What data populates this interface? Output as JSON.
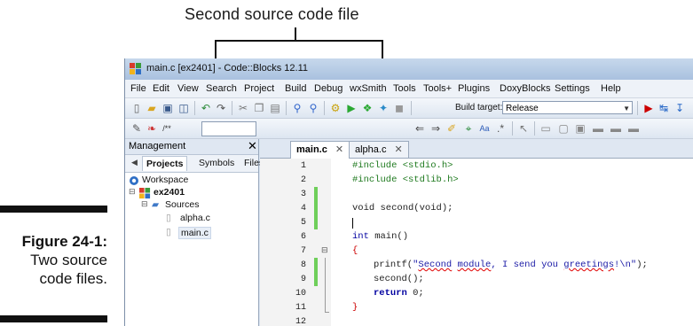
{
  "callout": {
    "label": "Second source code file"
  },
  "figure": {
    "number": "Figure 24-1:",
    "line1": "Two source",
    "line2": "code files."
  },
  "window": {
    "title": "main.c [ex2401] - Code::Blocks 12.11",
    "menu": [
      "File",
      "Edit",
      "View",
      "Search",
      "Project",
      "Build",
      "Debug",
      "wxSmith",
      "Tools",
      "Tools+",
      "Plugins",
      "DoxyBlocks",
      "Settings",
      "Help"
    ],
    "build_target_label": "Build target:",
    "build_target_value": "Release"
  },
  "management": {
    "header": "Management",
    "close": "✕",
    "tabs": [
      "Projects",
      "Symbols",
      "Files"
    ],
    "tree": {
      "workspace": "Workspace",
      "project": "ex2401",
      "folder": "Sources",
      "files": [
        "alpha.c",
        "main.c"
      ]
    }
  },
  "editor": {
    "tabs": [
      {
        "label": "main.c",
        "active": true
      },
      {
        "label": "alpha.c",
        "active": false
      }
    ],
    "tab_close": "✕",
    "line_numbers": [
      "1",
      "2",
      "3",
      "4",
      "5",
      "6",
      "7",
      "8",
      "9",
      "10",
      "11",
      "12"
    ],
    "code": {
      "l1": "#include <stdio.h>",
      "l2": "#include <stdlib.h>",
      "l4": "void second(void);",
      "l6_kw": "int",
      "l6_rest": " main()",
      "l7": "{",
      "l8_fn": "printf(",
      "l8_str_q": "\"",
      "l8_w1": "Second",
      "l8_w2": "module",
      "l8_mid": ", I send you ",
      "l8_w3": "greetings",
      "l8_end": "!\\n\"",
      "l8_close": ");",
      "l9": "second();",
      "l10_kw": "return",
      "l10_rest": " 0;",
      "l11": "}"
    }
  }
}
